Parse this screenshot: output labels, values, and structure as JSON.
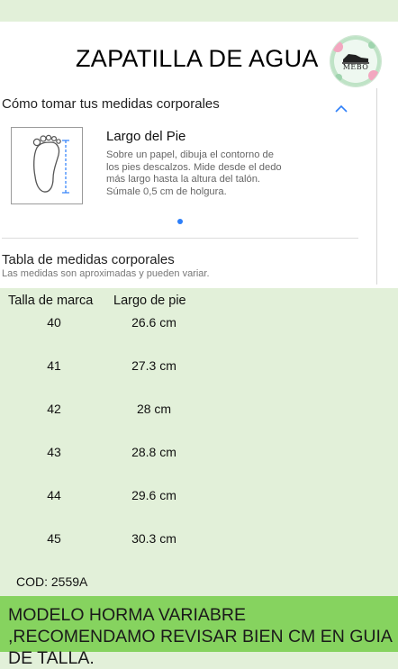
{
  "header": {
    "title": "ZAPATILLA DE AGUA"
  },
  "logo": {
    "text": "MEBO",
    "icon": "shoe-icon"
  },
  "measure": {
    "section_title": "Cómo tomar tus medidas corporales",
    "toggle_icon": "chevron-up-icon",
    "item_title": "Largo del Pie",
    "item_description": "Sobre un papel, dibuja el contorno de los pies descalzos. Mide desde el dedo más largo hasta la altura del talón. Súmale 0,5 cm de holgura.",
    "accent_color": "#2d7ff9"
  },
  "size_table": {
    "title": "Tabla de medidas corporales",
    "subtitle": "Las medidas son aproximadas y pueden variar.",
    "headers": [
      "Talla de marca",
      "Largo de pie"
    ],
    "rows": [
      [
        "40",
        "26.6 cm"
      ],
      [
        "41",
        "27.3 cm"
      ],
      [
        "42",
        "28 cm"
      ],
      [
        "43",
        "28.8 cm"
      ],
      [
        "44",
        "29.6 cm"
      ],
      [
        "45",
        "30.3 cm"
      ]
    ]
  },
  "code": "COD: 2559A",
  "banner": {
    "text": "MODELO HORMA VARIABRE ,RECOMENDAMO REVISAR BIEN CM EN GUIA DE TALLA.",
    "color": "#86d35f"
  },
  "background_color": "#e2f0d9"
}
